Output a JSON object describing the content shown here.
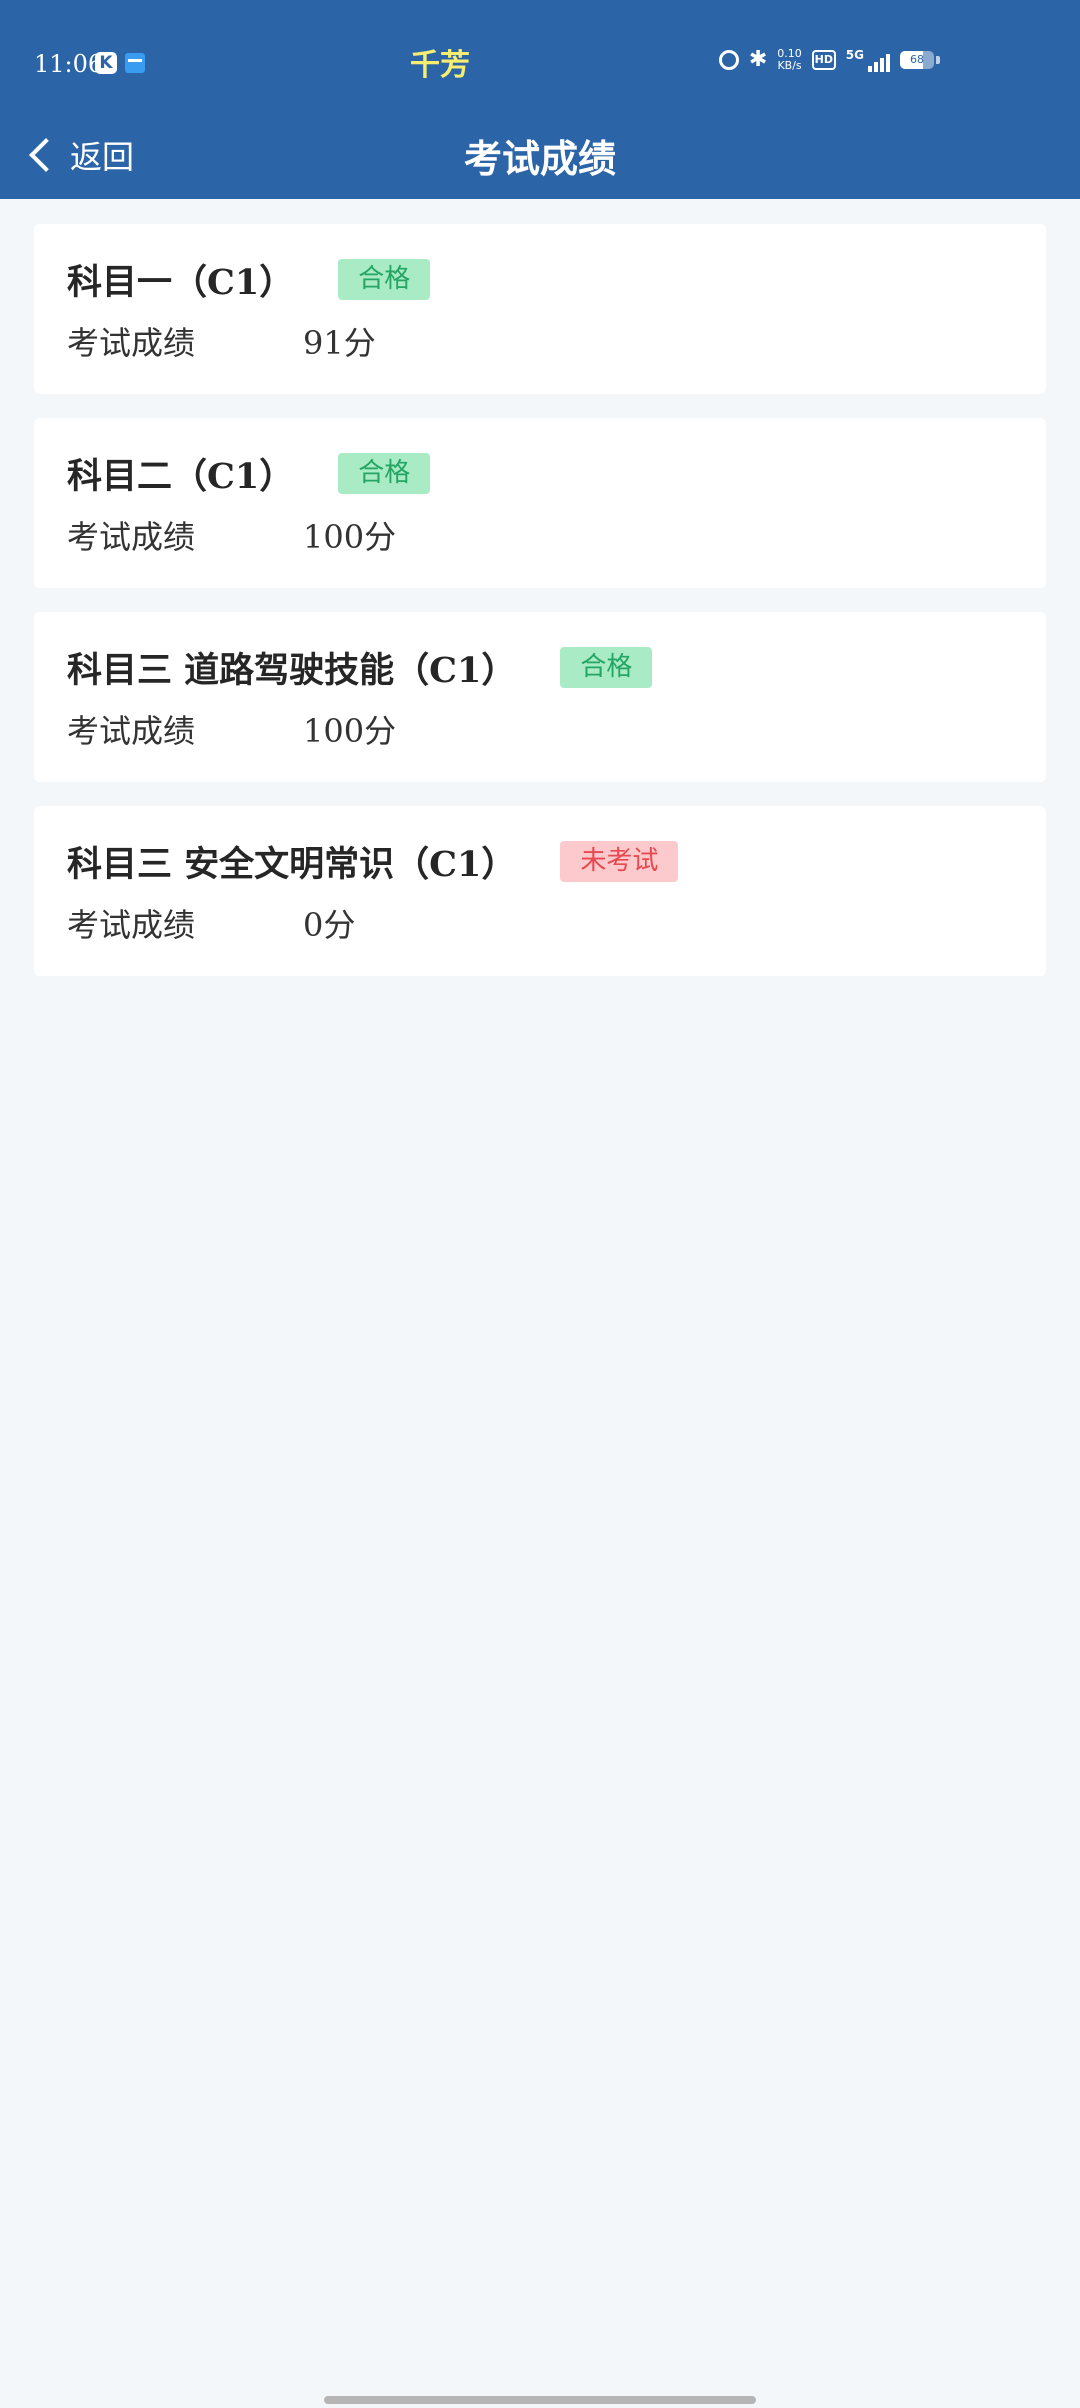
{
  "status_bar": {
    "time": "11:06",
    "carrier": "千芳",
    "speed_top": "0.10",
    "speed_bottom": "KB/s",
    "hd": "HD",
    "network": "5G",
    "battery": "68",
    "battery_level": 0.68
  },
  "nav": {
    "back_label": "返回",
    "title": "考试成绩"
  },
  "cards": [
    {
      "title": "科目一（C1）",
      "status": "合格",
      "score_label": "考试成绩",
      "score": "91分"
    },
    {
      "title": "科目二（C1）",
      "status": "合格",
      "score_label": "考试成绩",
      "score": "100分"
    },
    {
      "title": "科目三 道路驾驶技能（C1）",
      "status": "合格",
      "score_label": "考试成绩",
      "score": "100分"
    },
    {
      "title": "科目三 安全文明常识（C1）",
      "status": "未考试",
      "score_label": "考试成绩",
      "score": "0分"
    }
  ],
  "colors": {
    "header_bg": "#2b65a8",
    "page_bg": "#f4f7f9",
    "pass_bg": "#a9ebc5",
    "pass_text": "#24a564",
    "fail_bg": "#fcc9cc",
    "fail_text": "#e6494f",
    "carrier_text": "#f7ee6f"
  }
}
